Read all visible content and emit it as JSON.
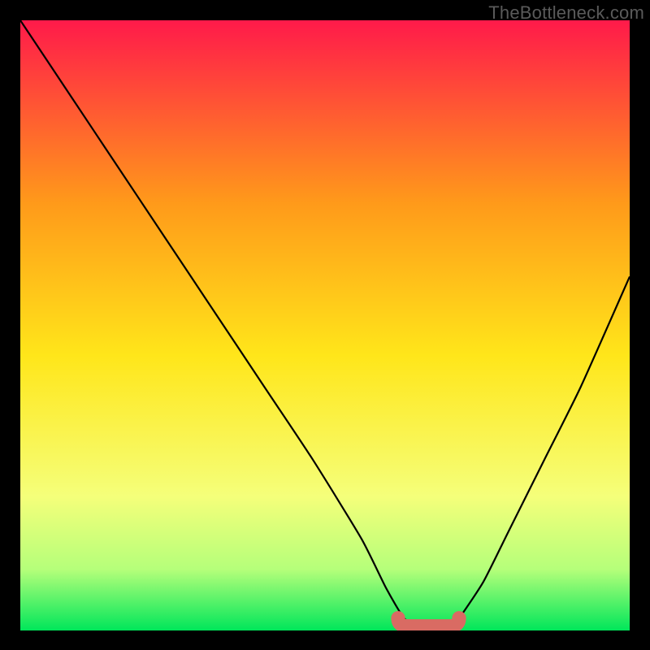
{
  "watermark": "TheBottleneck.com",
  "chart_data": {
    "type": "line",
    "title": "",
    "xlabel": "",
    "ylabel": "",
    "xlim": [
      0,
      100
    ],
    "ylim": [
      0,
      100
    ],
    "grid": false,
    "legend": false,
    "gradient_colors": {
      "top": "#ff1a4a",
      "mid_upper": "#ff9a1a",
      "mid": "#ffe61a",
      "lower": "#f5ff7a",
      "near_bottom": "#b5ff7a",
      "bottom": "#00e65a"
    },
    "series": [
      {
        "name": "curve",
        "color": "#000000",
        "x": [
          0,
          8,
          16,
          24,
          32,
          40,
          48,
          56,
          60,
          63,
          66,
          70,
          72,
          76,
          80,
          86,
          92,
          100
        ],
        "values": [
          100,
          88,
          76,
          64,
          52,
          40,
          28,
          15,
          7,
          2,
          0,
          0,
          2,
          8,
          16,
          28,
          40,
          58
        ]
      }
    ],
    "bottom_marker": {
      "color": "#d96b63",
      "x_start": 62,
      "x_end": 72,
      "y": 1.5,
      "thickness": 2.3
    }
  }
}
